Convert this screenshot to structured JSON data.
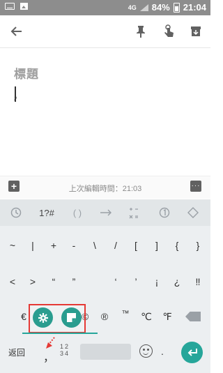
{
  "status_bar": {
    "battery": "84%",
    "time": "21:04",
    "network": "4G"
  },
  "note": {
    "title_placeholder": "標題",
    "body_text": "，"
  },
  "bottom_bar": {
    "last_edited": "上次編輯時間：21:03"
  },
  "keyboard": {
    "top_row": [
      "1?#",
      "( )"
    ],
    "row1": [
      "~",
      "|",
      "+",
      "-",
      "\\",
      "/",
      "[",
      "]",
      "{",
      "}"
    ],
    "row2": [
      "<",
      ">",
      "“",
      "”",
      "‘",
      "’",
      "¡",
      "¿",
      "‼"
    ],
    "row3": [
      "€",
      "©",
      "®",
      "™",
      "℃",
      "℉"
    ],
    "bottom": {
      "return_label": "返回",
      "comma": "，",
      "numpad_top": "12",
      "numpad_bottom": "34",
      "period": "."
    }
  },
  "colors": {
    "accent": "#26a69a",
    "annotation": "#e53935"
  }
}
